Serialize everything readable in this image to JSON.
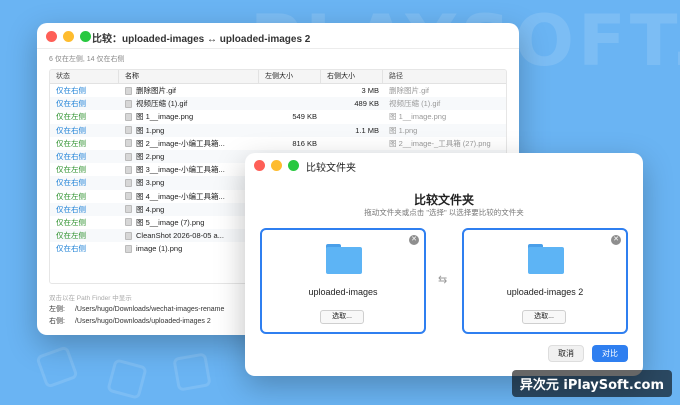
{
  "background": {
    "accent": "#6ab4f3",
    "text": "PLAYSOFT.IPHEE"
  },
  "watermark": "异次元 iPlaySoft.com",
  "main_window": {
    "title": "比较：uploaded-images ↔ uploaded-images 2",
    "summary": "6 仅在左侧, 14 仅在右侧",
    "columns": [
      "状态",
      "名称",
      "左侧大小",
      "右侧大小",
      "路径"
    ],
    "rows": [
      {
        "status": "仅在右侧",
        "side": "right",
        "name": "删除图片.gif",
        "left_size": "",
        "right_size": "3 MB",
        "path": "删除图片.gif"
      },
      {
        "status": "仅在右侧",
        "side": "right",
        "name": "视频压缩 (1).gif",
        "left_size": "",
        "right_size": "489 KB",
        "path": "视频压缩 (1).gif"
      },
      {
        "status": "仅在左侧",
        "side": "left",
        "name": "图 1__image.png",
        "left_size": "549 KB",
        "right_size": "",
        "path": "图 1__image.png"
      },
      {
        "status": "仅在右侧",
        "side": "right",
        "name": "图 1.png",
        "left_size": "",
        "right_size": "1.1 MB",
        "path": "图 1.png"
      },
      {
        "status": "仅在左侧",
        "side": "left",
        "name": "图 2__image-小编工具箱...",
        "left_size": "816 KB",
        "right_size": "",
        "path": "图 2__image-_工具箱 (27).png"
      },
      {
        "status": "仅在右侧",
        "side": "right",
        "name": "图 2.png",
        "left_size": "",
        "right_size": "",
        "path": ""
      },
      {
        "status": "仅在左侧",
        "side": "left",
        "name": "图 3__image-小编工具箱...",
        "left_size": "",
        "right_size": "",
        "path": ""
      },
      {
        "status": "仅在右侧",
        "side": "right",
        "name": "图 3.png",
        "left_size": "",
        "right_size": "",
        "path": ""
      },
      {
        "status": "仅在左侧",
        "side": "left",
        "name": "图 4__image-小编工具箱...",
        "left_size": "",
        "right_size": "",
        "path": ""
      },
      {
        "status": "仅在右侧",
        "side": "right",
        "name": "图 4.png",
        "left_size": "",
        "right_size": "",
        "path": ""
      },
      {
        "status": "仅在左侧",
        "side": "left",
        "name": "图 5__image (7).png",
        "left_size": "",
        "right_size": "",
        "path": ""
      },
      {
        "status": "仅在左侧",
        "side": "left",
        "name": "CleanShot 2026-08-05 a...",
        "left_size": "",
        "right_size": "",
        "path": ""
      },
      {
        "status": "仅在右侧",
        "side": "right",
        "name": "image (1).png",
        "left_size": "",
        "right_size": "",
        "path": ""
      }
    ],
    "hint": "双击以在 Path Finder 中显示",
    "left_label": "左侧:",
    "left_path": "/Users/hugo/Downloads/wechat-images-rename",
    "right_label": "右侧:",
    "right_path": "/Users/hugo/Downloads/uploaded-images 2"
  },
  "dialog": {
    "window_title": "比较文件夹",
    "heading": "比较文件夹",
    "subheading": "拖动文件夹或点击 \"选择\" 以选择要比较的文件夹",
    "left_folder": "uploaded-images",
    "right_folder": "uploaded-images 2",
    "choose_label": "选取...",
    "cancel_label": "取消",
    "compare_label": "对比"
  }
}
